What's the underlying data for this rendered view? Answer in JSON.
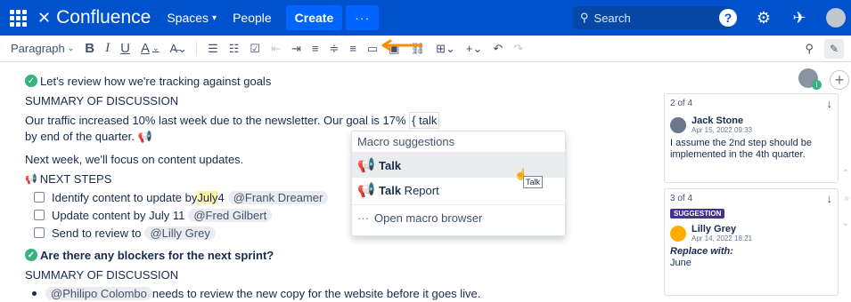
{
  "topbar": {
    "logo": "Confluence",
    "nav": [
      "Spaces",
      "People"
    ],
    "create": "Create",
    "more": "···",
    "search_placeholder": "Search"
  },
  "toolbar": {
    "paragraph": "Paragraph",
    "bold": "B",
    "italic": "I",
    "underline": "U",
    "text_color": "A"
  },
  "content": {
    "heading1": "Let's review how we're tracking against goals",
    "summary1": "SUMMARY OF DISCUSSION",
    "para1_a": "Our traffic increased 10% last week due to the newsletter. Our goal is 17% ",
    "para1_token": "{ talk",
    "para1_b": "by end of the quarter.",
    "para2": "Next week, we'll focus on content updates.",
    "next_steps": "NEXT STEPS",
    "tasks": [
      {
        "pre": "Identify content to update by ",
        "hl": "July",
        "post": " 4",
        "mention": "@Frank Dreamer"
      },
      {
        "pre": "Update content by July 11",
        "hl": "",
        "post": "",
        "mention": "@Fred Gilbert"
      },
      {
        "pre": "Send to review to",
        "hl": "",
        "post": "",
        "mention": "@Lilly Grey"
      }
    ],
    "heading2": "Are there any blockers for the next sprint?",
    "summary2": "SUMMARY OF DISCUSSION",
    "bullet_mention": "@Philipo Colombo",
    "bullet_text": " needs to review the new copy for the website before it goes live."
  },
  "macro": {
    "header": "Macro suggestions",
    "items": [
      {
        "bold": "Talk",
        "rest": ""
      },
      {
        "bold": "Talk",
        "rest": " Report"
      }
    ],
    "browse": "Open macro browser",
    "tooltip": "Talk"
  },
  "comments": {
    "card1": {
      "count": "2 of 4",
      "name": "Jack Stone",
      "date": "Apr 15, 2022 09:33",
      "body": "I assume the 2nd step should be implemented in the 4th quarter."
    },
    "card2": {
      "count": "3 of 4",
      "badge": "SUGGESTION",
      "name": "Lilly Grey",
      "date": "Apr 14, 2022 18:21",
      "replace": "Replace with:",
      "body": "June"
    },
    "side_avatar_badge": "i"
  }
}
